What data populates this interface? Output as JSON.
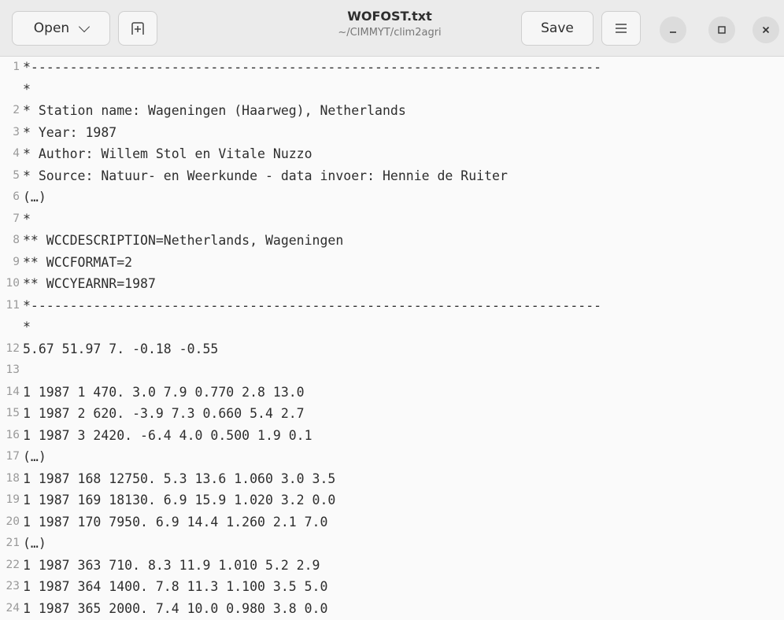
{
  "header": {
    "open_label": "Open",
    "title": "WOFOST.txt",
    "subtitle": "~/CIMMYT/clim2agri",
    "save_label": "Save"
  },
  "icons": {
    "open_dropdown": "chevron-down-icon",
    "new_tab": "new-tab-icon",
    "menu": "hamburger-menu-icon",
    "minimize": "minimize-icon",
    "maximize": "maximize-icon",
    "close": "close-icon"
  },
  "editor": {
    "lines": [
      {
        "num": "1",
        "text": "*-------------------------------------------------------------------------"
      },
      {
        "num": "",
        "text": "*"
      },
      {
        "num": "2",
        "text": "* Station name: Wageningen (Haarweg), Netherlands"
      },
      {
        "num": "3",
        "text": "* Year: 1987"
      },
      {
        "num": "4",
        "text": "* Author: Willem Stol en Vitale Nuzzo"
      },
      {
        "num": "5",
        "text": "* Source: Natuur- en Weerkunde - data invoer: Hennie de Ruiter"
      },
      {
        "num": "6",
        "text": "(…)"
      },
      {
        "num": "7",
        "text": "*"
      },
      {
        "num": "8",
        "text": "** WCCDESCRIPTION=Netherlands, Wageningen"
      },
      {
        "num": "9",
        "text": "** WCCFORMAT=2"
      },
      {
        "num": "10",
        "text": "** WCCYEARNR=1987"
      },
      {
        "num": "11",
        "text": "*-------------------------------------------------------------------------"
      },
      {
        "num": "",
        "text": "*"
      },
      {
        "num": "12",
        "text": "5.67 51.97 7. -0.18 -0.55"
      },
      {
        "num": "13",
        "text": ""
      },
      {
        "num": "14",
        "text": "1 1987 1 470. 3.0 7.9 0.770 2.8 13.0"
      },
      {
        "num": "15",
        "text": "1 1987 2 620. -3.9 7.3 0.660 5.4 2.7"
      },
      {
        "num": "16",
        "text": "1 1987 3 2420. -6.4 4.0 0.500 1.9 0.1"
      },
      {
        "num": "17",
        "text": "(…)"
      },
      {
        "num": "18",
        "text": "1 1987 168 12750. 5.3 13.6 1.060 3.0 3.5"
      },
      {
        "num": "19",
        "text": "1 1987 169 18130. 6.9 15.9 1.020 3.2 0.0"
      },
      {
        "num": "20",
        "text": "1 1987 170 7950. 6.9 14.4 1.260 2.1 7.0"
      },
      {
        "num": "21",
        "text": "(…)"
      },
      {
        "num": "22",
        "text": "1 1987 363 710. 8.3 11.9 1.010 5.2 2.9"
      },
      {
        "num": "23",
        "text": "1 1987 364 1400. 7.8 11.3 1.100 3.5 5.0"
      },
      {
        "num": "24",
        "text": "1 1987 365 2000. 7.4 10.0 0.980 3.8 0.0"
      },
      {
        "num": "25",
        "text": ""
      }
    ]
  }
}
